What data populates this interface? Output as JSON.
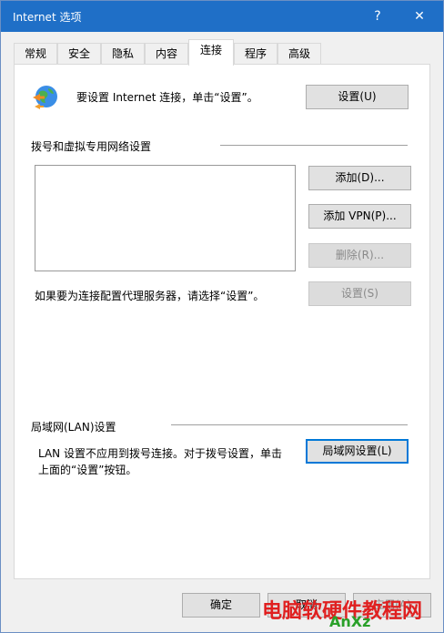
{
  "window": {
    "title": "Internet 选项",
    "help_glyph": "?",
    "close_glyph": "✕"
  },
  "tabs": [
    {
      "label": "常规"
    },
    {
      "label": "安全"
    },
    {
      "label": "隐私"
    },
    {
      "label": "内容"
    },
    {
      "label": "连接"
    },
    {
      "label": "程序"
    },
    {
      "label": "高级"
    }
  ],
  "active_tab": "连接",
  "connection": {
    "setup_text": "要设置 Internet 连接，单击“设置”。",
    "setup_button": "设置(U)"
  },
  "dialup": {
    "heading": "拨号和虚拟专用网络设置",
    "add_button": "添加(D)...",
    "add_vpn_button": "添加 VPN(P)...",
    "remove_button": "删除(R)...",
    "proxy_text": "如果要为连接配置代理服务器，请选择“设置”。",
    "settings_button": "设置(S)"
  },
  "lan": {
    "heading": "局域网(LAN)设置",
    "description_line1": "LAN 设置不应用到拨号连接。对于拨号设置，单击",
    "description_line2": "上面的“设置”按钮。",
    "lan_button": "局域网设置(L)"
  },
  "footer": {
    "ok_button": "确定",
    "cancel_button": "取消",
    "apply_button": "应用(A)"
  },
  "watermark": {
    "text": "电脑软硬件教程网",
    "sub": "AnXz"
  },
  "colors": {
    "titlebar": "#1f6fc7",
    "accent": "#0078d7",
    "watermark": "#e02020"
  }
}
